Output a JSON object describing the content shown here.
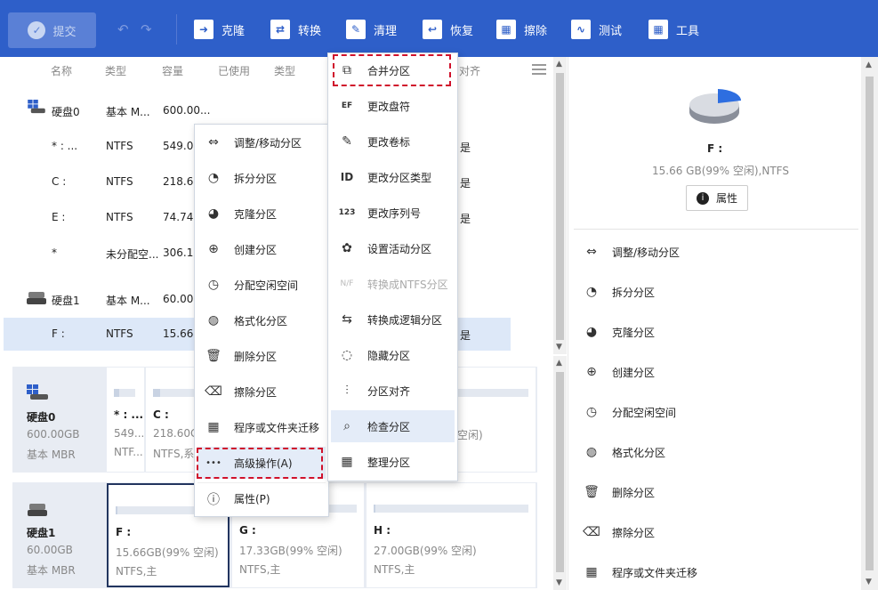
{
  "toolbar": {
    "submit": "提交",
    "undo": "↶",
    "redo": "↷",
    "buttons": [
      {
        "label": "克隆",
        "icon": "clone-icon",
        "glyph": "➜"
      },
      {
        "label": "转换",
        "icon": "convert-icon",
        "glyph": "⇄"
      },
      {
        "label": "清理",
        "icon": "cleanup-icon",
        "glyph": "✎"
      },
      {
        "label": "恢复",
        "icon": "recover-icon",
        "glyph": "↩"
      },
      {
        "label": "擦除",
        "icon": "wipe-icon",
        "glyph": "▦"
      },
      {
        "label": "测试",
        "icon": "test-icon",
        "glyph": "∿"
      },
      {
        "label": "工具",
        "icon": "tools-icon",
        "glyph": "▦"
      }
    ]
  },
  "columns": [
    "名称",
    "类型",
    "容量",
    "已使用",
    "类型",
    "对齐"
  ],
  "rows": [
    {
      "name": "硬盘0",
      "type": "基本 M...",
      "cap": "600.00..."
    },
    {
      "name": "* : ...",
      "type": "NTFS",
      "cap": "549.00",
      "right": "是"
    },
    {
      "name": "C :",
      "type": "NTFS",
      "cap": "218.60",
      "right": "是"
    },
    {
      "name": "E :",
      "type": "NTFS",
      "cap": "74.740",
      "right": "是"
    },
    {
      "name": "*",
      "type": "未分配空...",
      "cap": "306.11",
      "right": ""
    },
    {
      "name": "硬盘1",
      "type": "基本 M...",
      "cap": "60.000",
      "right": ""
    },
    {
      "name": "F :",
      "type": "NTFS",
      "cap": "15.660",
      "right": "是"
    }
  ],
  "disk0": {
    "name": "硬盘0",
    "size": "600.00GB",
    "type": "基本 MBR",
    "parts": [
      {
        "n": "* : ...",
        "a": "549...",
        "b": "NTF..."
      },
      {
        "n": "C :",
        "a": "218.60G",
        "b": "NTFS,系统"
      },
      {
        "n": "",
        "a": "空闲)",
        "b": ""
      }
    ]
  },
  "disk1": {
    "name": "硬盘1",
    "size": "60.00GB",
    "type": "基本 MBR",
    "parts": [
      {
        "n": "F :",
        "a": "15.66GB(99% 空闲)",
        "b": "NTFS,主"
      },
      {
        "n": "G :",
        "a": "17.33GB(99% 空闲)",
        "b": "NTFS,主"
      },
      {
        "n": "H :",
        "a": "27.00GB(99% 空闲)",
        "b": "NTFS,主"
      }
    ]
  },
  "details": {
    "drive": "F :",
    "info": "15.66 GB(99% 空闲),NTFS",
    "prop_btn": "属性"
  },
  "ops": [
    {
      "label": "调整/移动分区",
      "icon": "resize-icon",
      "glyph": "⇔"
    },
    {
      "label": "拆分分区",
      "icon": "split-icon",
      "glyph": "◔"
    },
    {
      "label": "克隆分区",
      "icon": "clone-partition-icon",
      "glyph": "◕"
    },
    {
      "label": "创建分区",
      "icon": "create-partition-icon",
      "glyph": "⊕"
    },
    {
      "label": "分配空闲空间",
      "icon": "allocate-icon",
      "glyph": "◷"
    },
    {
      "label": "格式化分区",
      "icon": "format-icon",
      "glyph": "◍"
    },
    {
      "label": "删除分区",
      "icon": "delete-icon",
      "glyph": "🗑"
    },
    {
      "label": "擦除分区",
      "icon": "wipe-partition-icon",
      "glyph": "⌫"
    },
    {
      "label": "程序或文件夹迁移",
      "icon": "migrate-icon",
      "glyph": "▦"
    }
  ],
  "context_menu": {
    "items": [
      {
        "label": "调整/移动分区",
        "icon": "resize-icon",
        "glyph": "⇔"
      },
      {
        "label": "拆分分区",
        "icon": "split-icon",
        "glyph": "◔"
      },
      {
        "label": "克隆分区",
        "icon": "clone-partition-icon",
        "glyph": "◕"
      },
      {
        "label": "创建分区",
        "icon": "create-partition-icon",
        "glyph": "⊕"
      },
      {
        "label": "分配空闲空间",
        "icon": "allocate-icon",
        "glyph": "◷"
      },
      {
        "label": "格式化分区",
        "icon": "format-icon",
        "glyph": "◍"
      },
      {
        "label": "删除分区",
        "icon": "delete-icon",
        "glyph": "🗑"
      },
      {
        "label": "擦除分区",
        "icon": "wipe-partition-icon",
        "glyph": "⌫"
      },
      {
        "label": "程序或文件夹迁移",
        "icon": "migrate-icon",
        "glyph": "▦"
      },
      {
        "label": "高级操作(A)",
        "icon": "more-icon",
        "glyph": "•••"
      },
      {
        "label": "属性(P)",
        "icon": "info-icon",
        "glyph": "ⓘ"
      }
    ]
  },
  "sub_menu": {
    "items": [
      {
        "label": "合并分区",
        "icon": "merge-icon",
        "glyph": "⧉"
      },
      {
        "label": "更改盘符",
        "icon": "drive-letter-icon",
        "glyph": "EF"
      },
      {
        "label": "更改卷标",
        "icon": "pencil-icon",
        "glyph": "✎"
      },
      {
        "label": "更改分区类型",
        "icon": "id-icon",
        "glyph": "ID"
      },
      {
        "label": "更改序列号",
        "icon": "serial-icon",
        "glyph": "123"
      },
      {
        "label": "设置活动分区",
        "icon": "active-icon",
        "glyph": "✿"
      },
      {
        "label": "转换成NTFS分区",
        "icon": "ntfs-icon",
        "glyph": "N/F",
        "disabled": true
      },
      {
        "label": "转换成逻辑分区",
        "icon": "logical-icon",
        "glyph": "⇆"
      },
      {
        "label": "隐藏分区",
        "icon": "hide-icon",
        "glyph": "◌"
      },
      {
        "label": "分区对齐",
        "icon": "align-icon",
        "glyph": "⫶"
      },
      {
        "label": "检查分区",
        "icon": "check-icon",
        "glyph": "⌕"
      },
      {
        "label": "整理分区",
        "icon": "defrag-icon",
        "glyph": "▦"
      }
    ]
  }
}
